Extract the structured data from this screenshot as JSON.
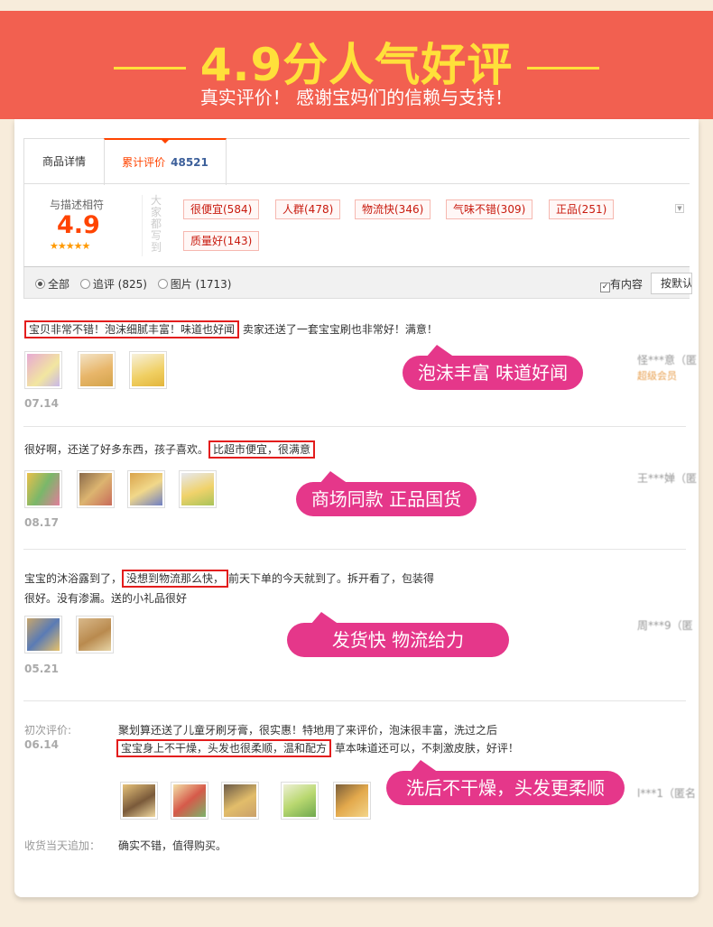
{
  "banner": {
    "title": "4.9分人气好评",
    "subtitle": "真实评价！ 感谢宝妈们的信赖与支持！"
  },
  "tabs": {
    "detail": "商品详情",
    "reviews": "累计评价",
    "reviews_count": "48521"
  },
  "summary": {
    "score_label": "与描述相符",
    "score": "4.9",
    "stars": "★★★★★",
    "vertical_label": "大家都写到",
    "tags": [
      "很便宜(584)",
      "人群(478)",
      "物流快(346)",
      "气味不错(309)",
      "正品(251)",
      "质量好(143)"
    ]
  },
  "filters": {
    "options": [
      "全部",
      "追评 (825)",
      "图片 (1713)"
    ],
    "selected": "全部",
    "has_content": "有内容",
    "sort": "按默认"
  },
  "reviews": [
    {
      "pre": "",
      "highlight": "宝贝非常不错！泡沫细腻丰富！味道也好闻",
      "post": "卖家还送了一套宝宝刷也非常好！满意！",
      "date": "07.14",
      "user": "怪***意（匿",
      "badge": "超级会员",
      "bubble": "泡沫丰富 味道好闻"
    },
    {
      "pre": "很好啊，还送了好多东西，孩子喜欢。",
      "highlight": "比超市便宜，很满意",
      "post": "",
      "date": "08.17",
      "user": "王***婵（匿",
      "bubble": "商场同款 正品国货"
    },
    {
      "pre": "宝宝的沐浴露到了，",
      "highlight": "没想到物流那么快，",
      "post": "前天下单的今天就到了。拆开看了，包装得",
      "line2": "很好。没有渗漏。送的小礼品很好",
      "date": "05.21",
      "user": "周***9（匿",
      "bubble": "发货快  物流给力"
    },
    {
      "initial_label": "初次评价:",
      "line1": "聚划算还送了儿童牙刷牙膏，很实惠！特地用了来评价，泡沫很丰富，洗过之后",
      "highlight": "宝宝身上不干燥，头发也很柔顺，温和配方",
      "post": "草本味道还可以，不刺激皮肤，好评！",
      "date": "06.14",
      "user": "l***1（匿名",
      "bubble": "洗后不干燥，头发更柔顺",
      "append_label": "收货当天追加：",
      "append_text": "确实不错，值得购买。"
    }
  ],
  "colors": {
    "banner_bg": "#f26050",
    "banner_title": "#ffe03a",
    "bubble": "#e5378a",
    "highlight_border": "#e31d1d",
    "score": "#ff4400"
  }
}
